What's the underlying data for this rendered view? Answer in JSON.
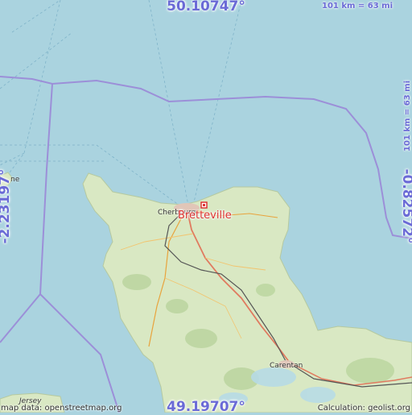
{
  "map": {
    "place_name": "Bretteville",
    "lat_top": "50.10747°",
    "lat_bottom": "49.19707°",
    "lon_left": "-2.23197°",
    "lon_right": "-0.82572°",
    "scale_horizontal": "101 km = 63 mi",
    "scale_vertical": "101 km = 63 mi",
    "labels": {
      "cherbourg": "Cherbourg",
      "carentan": "Carentan",
      "jersey": "Jersey",
      "island_fragment": "ne"
    },
    "attribution_left": "map data: openstreetmap.org",
    "attribution_right": "Calculation: geolist.org",
    "colors": {
      "sea": "#aad3df",
      "land": "#d9e8c3",
      "boundary": "#9c8fd8",
      "coord_text": "#6a6ad6",
      "marker": "#d33"
    },
    "icons": [
      "place-marker-icon"
    ]
  }
}
